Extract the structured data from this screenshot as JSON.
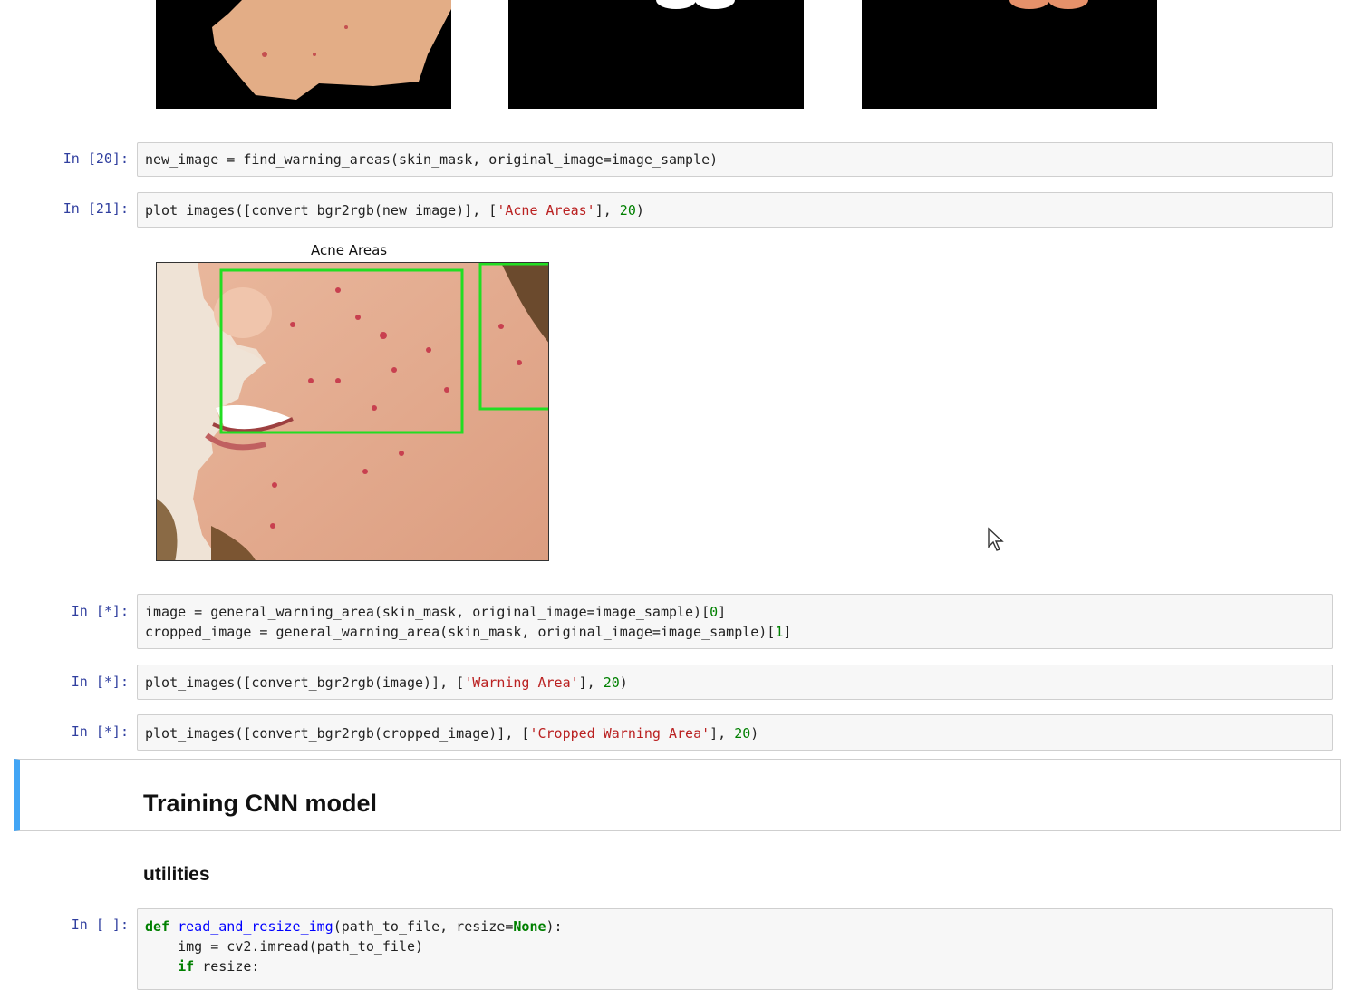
{
  "prompts": {
    "p20": "In [20]:",
    "p21": "In [21]:",
    "pstar1": "In [*]:",
    "pstar2": "In [*]:",
    "pstar3": "In [*]:",
    "pempty": "In [ ]:"
  },
  "cells": {
    "c20": "new_image = find_warning_areas(skin_mask, original_image=image_sample)",
    "c21_a": "plot_images([convert_bgr2rgb(new_image)], [",
    "c21_str": "'Acne Areas'",
    "c21_b": "], ",
    "c21_num": "20",
    "c21_c": ")",
    "cs1_l1a": "image = general_warning_area(skin_mask, original_image=image_sample)[",
    "cs1_l1n": "0",
    "cs1_l1b": "]",
    "cs1_l2a": "cropped_image = general_warning_area(skin_mask, original_image=image_sample)[",
    "cs1_l2n": "1",
    "cs1_l2b": "]",
    "cs2_a": "plot_images([convert_bgr2rgb(image)], [",
    "cs2_str": "'Warning Area'",
    "cs2_b": "], ",
    "cs2_num": "20",
    "cs2_c": ")",
    "cs3_a": "plot_images([convert_bgr2rgb(cropped_image)], [",
    "cs3_str": "'Cropped Warning Area'",
    "cs3_b": "], ",
    "cs3_num": "20",
    "cs3_c": ")",
    "def_kw": "def",
    "def_fn": "read_and_resize_img",
    "def_a": "(path_to_file, resize=",
    "def_none": "None",
    "def_b": "):",
    "l2": "    img = cv2.imread(path_to_file)",
    "l3_kw": "if",
    "l3_rest": " resize:"
  },
  "figure": {
    "title": "Acne Areas"
  },
  "markdown": {
    "heading": "Training CNN model",
    "subheading": "utilities"
  },
  "colors": {
    "accent": "#42a5f5",
    "box": "#22dd22"
  }
}
